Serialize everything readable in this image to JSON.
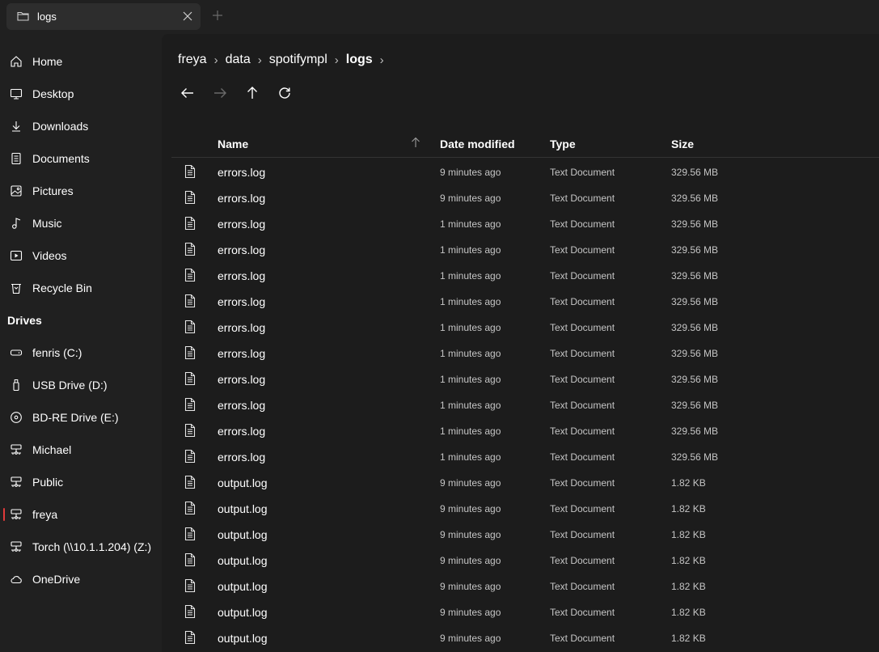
{
  "tab": {
    "title": "logs"
  },
  "sidebar": {
    "items": [
      {
        "label": "Home",
        "icon": "home-icon"
      },
      {
        "label": "Desktop",
        "icon": "desktop-icon"
      },
      {
        "label": "Downloads",
        "icon": "download-icon"
      },
      {
        "label": "Documents",
        "icon": "document-icon"
      },
      {
        "label": "Pictures",
        "icon": "picture-icon"
      },
      {
        "label": "Music",
        "icon": "music-icon"
      },
      {
        "label": "Videos",
        "icon": "video-icon"
      },
      {
        "label": "Recycle Bin",
        "icon": "recycle-bin-icon"
      }
    ],
    "drives_header": "Drives",
    "drives": [
      {
        "label": "fenris (C:)",
        "icon": "hard-drive-icon"
      },
      {
        "label": "USB Drive (D:)",
        "icon": "usb-drive-icon"
      },
      {
        "label": "BD-RE Drive (E:)",
        "icon": "optical-drive-icon"
      },
      {
        "label": "Michael",
        "icon": "network-drive-icon"
      },
      {
        "label": "Public",
        "icon": "network-drive-icon"
      },
      {
        "label": "freya",
        "icon": "network-drive-icon",
        "active": true
      },
      {
        "label": "Torch (\\\\10.1.1.204) (Z:)",
        "icon": "network-drive-icon"
      },
      {
        "label": "OneDrive",
        "icon": "cloud-icon"
      }
    ]
  },
  "breadcrumb": [
    "freya",
    "data",
    "spotifympl",
    "logs"
  ],
  "columns": {
    "name": "Name",
    "date": "Date modified",
    "type": "Type",
    "size": "Size"
  },
  "files": [
    {
      "name": "errors.log",
      "date": "9 minutes ago",
      "type": "Text Document",
      "size": "329.56 MB"
    },
    {
      "name": "errors.log",
      "date": "9 minutes ago",
      "type": "Text Document",
      "size": "329.56 MB"
    },
    {
      "name": "errors.log",
      "date": "1 minutes ago",
      "type": "Text Document",
      "size": "329.56 MB"
    },
    {
      "name": "errors.log",
      "date": "1 minutes ago",
      "type": "Text Document",
      "size": "329.56 MB"
    },
    {
      "name": "errors.log",
      "date": "1 minutes ago",
      "type": "Text Document",
      "size": "329.56 MB"
    },
    {
      "name": "errors.log",
      "date": "1 minutes ago",
      "type": "Text Document",
      "size": "329.56 MB"
    },
    {
      "name": "errors.log",
      "date": "1 minutes ago",
      "type": "Text Document",
      "size": "329.56 MB"
    },
    {
      "name": "errors.log",
      "date": "1 minutes ago",
      "type": "Text Document",
      "size": "329.56 MB"
    },
    {
      "name": "errors.log",
      "date": "1 minutes ago",
      "type": "Text Document",
      "size": "329.56 MB"
    },
    {
      "name": "errors.log",
      "date": "1 minutes ago",
      "type": "Text Document",
      "size": "329.56 MB"
    },
    {
      "name": "errors.log",
      "date": "1 minutes ago",
      "type": "Text Document",
      "size": "329.56 MB"
    },
    {
      "name": "errors.log",
      "date": "1 minutes ago",
      "type": "Text Document",
      "size": "329.56 MB"
    },
    {
      "name": "output.log",
      "date": "9 minutes ago",
      "type": "Text Document",
      "size": "1.82 KB"
    },
    {
      "name": "output.log",
      "date": "9 minutes ago",
      "type": "Text Document",
      "size": "1.82 KB"
    },
    {
      "name": "output.log",
      "date": "9 minutes ago",
      "type": "Text Document",
      "size": "1.82 KB"
    },
    {
      "name": "output.log",
      "date": "9 minutes ago",
      "type": "Text Document",
      "size": "1.82 KB"
    },
    {
      "name": "output.log",
      "date": "9 minutes ago",
      "type": "Text Document",
      "size": "1.82 KB"
    },
    {
      "name": "output.log",
      "date": "9 minutes ago",
      "type": "Text Document",
      "size": "1.82 KB"
    },
    {
      "name": "output.log",
      "date": "9 minutes ago",
      "type": "Text Document",
      "size": "1.82 KB"
    }
  ],
  "colors": {
    "accent": "#e03a3a",
    "background": "#202020",
    "content": "#1c1c1c"
  }
}
